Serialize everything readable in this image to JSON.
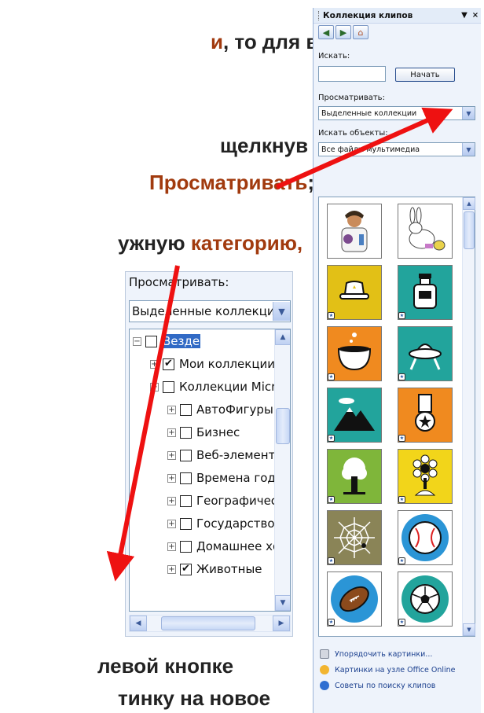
{
  "slide": {
    "line1_accent": "и",
    "line1_rest": ", то для вставки",
    "line2": "щелкнув левой",
    "line3_accent": "Просматривать",
    "line3_rest": ";",
    "line4_rest": "ужную ",
    "line4_accent": "категорию,",
    "line5": "левой  кнопке",
    "line6": "тинку на новое"
  },
  "pane": {
    "title": "Коллекция клипов",
    "title_controls": [
      "▼",
      "×"
    ],
    "nav": {
      "back_icon": "back-icon",
      "forward_icon": "forward-icon",
      "home_icon": "home-icon"
    },
    "search_label": "Искать:",
    "search_value": "",
    "go_button": "Начать",
    "browse_label": "Просматривать:",
    "browse_value": "Выделенные коллекции",
    "types_label": "Искать объекты:",
    "types_value": "Все файлы мультимедиа",
    "clips": [
      "doctor-clip",
      "rabbit-clip",
      "cowboy-hat-clip",
      "bottle-clip",
      "cauldron-clip",
      "ufo-clip",
      "mountain-clip",
      "medal-clip",
      "tree-clip",
      "flower-clip",
      "spider-web-clip",
      "baseball-clip",
      "football-clip",
      "soccer-ball-clip"
    ],
    "links": [
      {
        "icon": "organize-icon",
        "label": "Упорядочить картинки..."
      },
      {
        "icon": "office-online-icon",
        "label": "Картинки на узле Office Online"
      },
      {
        "icon": "help-icon",
        "label": "Советы по поиску клипов"
      }
    ]
  },
  "zoom": {
    "label": "Просматривать:",
    "value": "Выделенные коллекции",
    "tree": [
      {
        "label": "Везде",
        "expander": "−",
        "checked": false,
        "level": 0,
        "selected": true
      },
      {
        "label": "Мои коллекции",
        "expander": "+",
        "checked": true,
        "level": 1
      },
      {
        "label": "Коллекции Microsoft",
        "expander": "−",
        "checked": false,
        "level": 1
      },
      {
        "label": "АвтоФигуры",
        "expander": "+",
        "checked": false,
        "level": 2
      },
      {
        "label": "Бизнес",
        "expander": "+",
        "checked": false,
        "level": 2
      },
      {
        "label": "Веб-элементы",
        "expander": "+",
        "checked": false,
        "level": 2
      },
      {
        "label": "Времена года",
        "expander": "+",
        "checked": false,
        "level": 2
      },
      {
        "label": "Географические",
        "expander": "+",
        "checked": false,
        "level": 2
      },
      {
        "label": "Государство",
        "expander": "+",
        "checked": false,
        "level": 2
      },
      {
        "label": "Домашнее хозяй",
        "expander": "+",
        "checked": false,
        "level": 2
      },
      {
        "label": "Животные",
        "expander": "+",
        "checked": true,
        "level": 2
      }
    ]
  },
  "colors": {
    "accent": "#a13a0e",
    "arrow": "#ee1111",
    "selection": "#316ac5"
  }
}
